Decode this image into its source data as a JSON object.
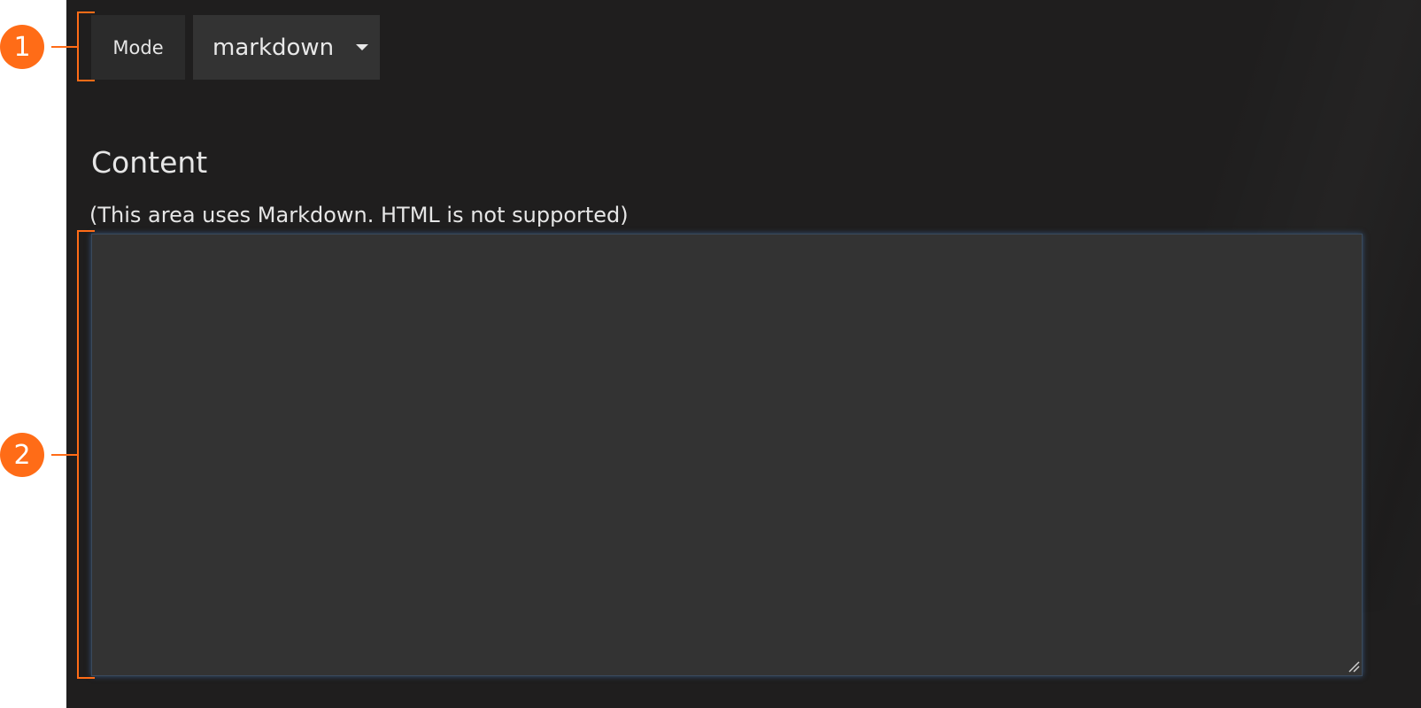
{
  "mode": {
    "label": "Mode",
    "selected": "markdown"
  },
  "content": {
    "title": "Content",
    "hint": "(This area uses Markdown. HTML is not supported)",
    "value": ""
  },
  "callouts": [
    "1",
    "2"
  ],
  "colors": {
    "panel_background": "#1f1e1e",
    "field_background": "#333333",
    "callout": "#ff6c17",
    "focus_glow": "#4682c8"
  },
  "icons": {
    "dropdown": "caret-down-icon",
    "resize": "resize-handle-icon"
  }
}
